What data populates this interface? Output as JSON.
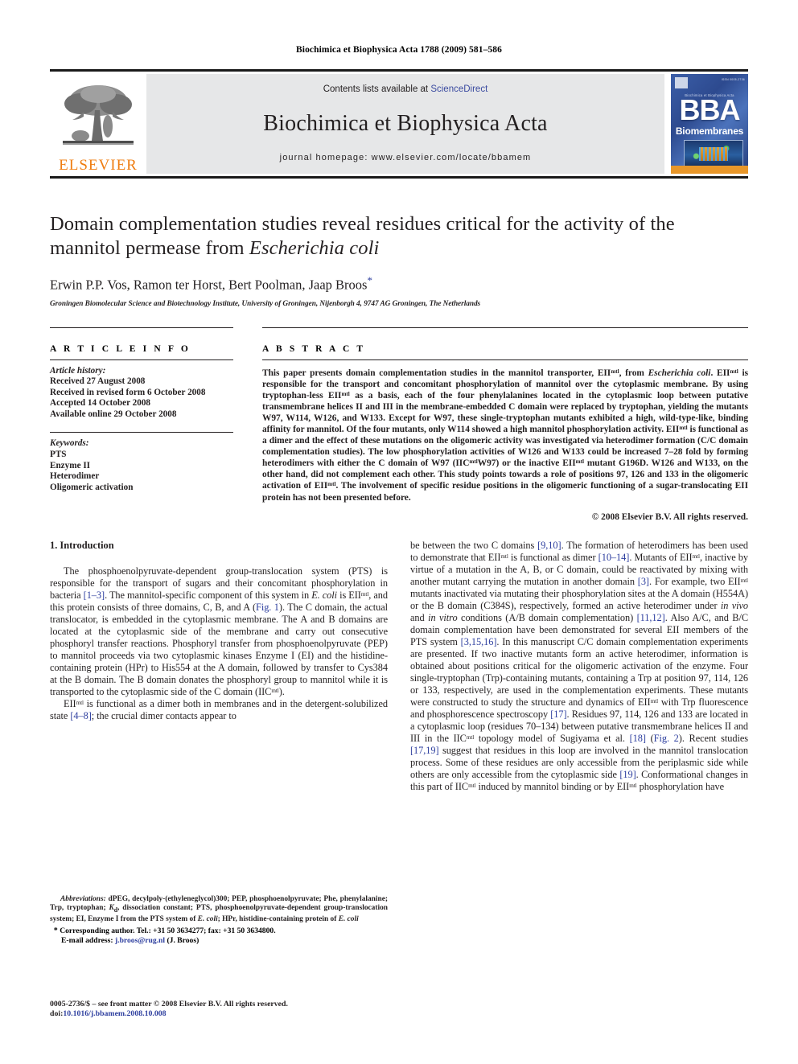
{
  "running_head": "Biochimica et Biophysica Acta 1788 (2009) 581–586",
  "header": {
    "contents_prefix": "Contents lists available at ",
    "sciencedirect": "ScienceDirect",
    "journal_name": "Biochimica et Biophysica Acta",
    "homepage": "journal homepage: www.elsevier.com/locate/bbamem",
    "elsevier_wordmark": "ELSEVIER",
    "cover": {
      "title": "BBA",
      "subtitle": "Biomembranes",
      "top_right": "ISSN 0005-2736",
      "masthead": "Biochimica et Biophysica Acta"
    },
    "accent_orange": "#ef7d11",
    "link_blue": "#3b4ba0",
    "band_gray": "#e6e7e8"
  },
  "article": {
    "title_part1": "Domain complementation studies reveal residues critical for the activity of the",
    "title_part2": "mannitol permease from ",
    "title_italic": "Escherichia coli",
    "authors": "Erwin P.P. Vos, Ramon ter Horst, Bert Poolman, Jaap Broos",
    "corresponding_marker": "*",
    "affiliation": "Groningen Biomolecular Science and Biotechnology Institute, University of Groningen, Nijenborgh 4, 9747 AG Groningen, The Netherlands"
  },
  "article_info": {
    "label": "A R T I C L E    I N F O",
    "history_label": "Article history:",
    "history": [
      "Received 27 August 2008",
      "Received in revised form 6 October 2008",
      "Accepted 14 October 2008",
      "Available online 29 October 2008"
    ],
    "keywords_label": "Keywords:",
    "keywords": [
      "PTS",
      "Enzyme II",
      "Heterodimer",
      "Oligomeric activation"
    ]
  },
  "abstract": {
    "label": "A B S T R A C T",
    "copyright": "© 2008 Elsevier B.V. All rights reserved."
  },
  "sections": {
    "intro_heading": "1. Introduction"
  },
  "footnotes": {
    "abbrev_label": "Abbreviations:",
    "corresponding": "Corresponding author. Tel.: +31 50 3634277; fax: +31 50 3634800.",
    "email_label": "E-mail address:",
    "email": "j.broos@rug.nl",
    "email_owner": "(J. Broos)",
    "star": "*"
  },
  "imprint": {
    "line1": "0005-2736/$ – see front matter © 2008 Elsevier B.V. All rights reserved.",
    "doi_label": "doi:",
    "doi": "10.1016/j.bbamem.2008.10.008"
  }
}
